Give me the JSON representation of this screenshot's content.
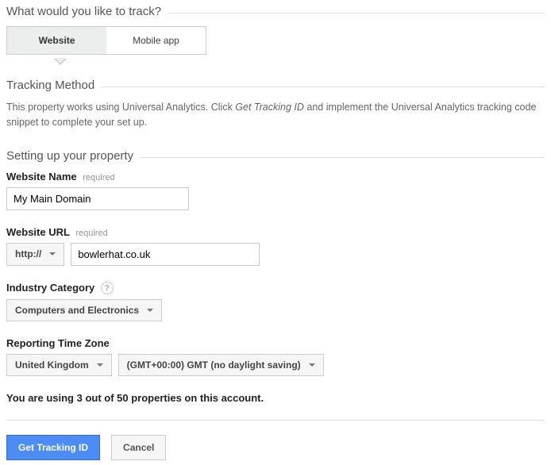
{
  "header": {
    "title": "What would you like to track?"
  },
  "tabs": {
    "website": "Website",
    "mobile_app": "Mobile app"
  },
  "tracking_method": {
    "title": "Tracking Method",
    "desc_pre": "This property works using Universal Analytics. Click ",
    "desc_em": "Get Tracking ID",
    "desc_post": " and implement the Universal Analytics tracking code snippet to complete your set up."
  },
  "setup": {
    "title": "Setting up your property",
    "website_name_label": "Website Name",
    "website_name_required": "required",
    "website_name_value": "My Main Domain",
    "website_url_label": "Website URL",
    "website_url_required": "required",
    "protocol": "http://",
    "website_url_value": "bowlerhat.co.uk",
    "industry_label": "Industry Category",
    "industry_value": "Computers and Electronics",
    "timezone_label": "Reporting Time Zone",
    "timezone_country": "United Kingdom",
    "timezone_gmt": "(GMT+00:00) GMT (no daylight saving)"
  },
  "usage_text": "You are using 3 out of 50 properties on this account.",
  "buttons": {
    "primary": "Get Tracking ID",
    "cancel": "Cancel"
  }
}
